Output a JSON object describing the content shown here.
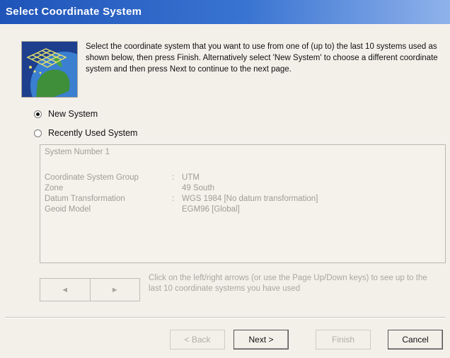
{
  "window": {
    "title": "Select Coordinate System"
  },
  "intro_text": "Select the coordinate system that you want to use from one of (up to) the last 10 systems used as shown below, then press Finish. Alternatively select 'New System' to choose a different coordinate system and then press Next to continue to the next page.",
  "options": {
    "new_system": {
      "label": "New System",
      "selected": true
    },
    "recent_system": {
      "label": "Recently Used System",
      "selected": false
    }
  },
  "system_info": {
    "title": "System Number 1",
    "rows": [
      {
        "label": "Coordinate System Group",
        "sep": ":",
        "value": "UTM"
      },
      {
        "label": "Zone",
        "sep": "",
        "value": "49 South"
      },
      {
        "label": "Datum Transformation",
        "sep": ":",
        "value": "WGS 1984 [No datum transformation]"
      },
      {
        "label": "Geoid Model",
        "sep": "",
        "value": "EGM96 [Global]"
      }
    ]
  },
  "nav": {
    "prev_glyph": "◄",
    "next_glyph": "►",
    "hint": "Click on the left/right arrows (or use the Page Up/Down keys) to see up to the last 10 coordinate systems you have used"
  },
  "buttons": {
    "back": "< Back",
    "next": "Next >",
    "finish": "Finish",
    "cancel": "Cancel"
  },
  "colors": {
    "title_bar": "#1f54b8",
    "dialog_bg": "#f3f0ea",
    "disabled_text": "#a9a69f"
  }
}
